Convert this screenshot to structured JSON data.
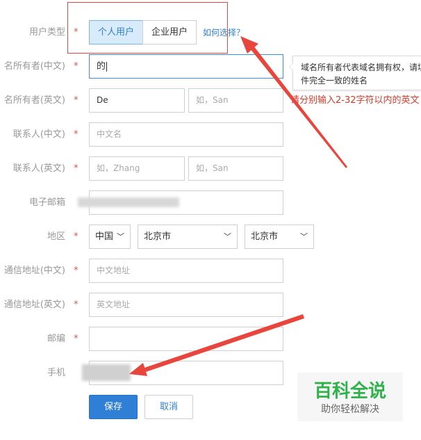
{
  "form": {
    "user_type": {
      "label": "用户类型",
      "required": "*",
      "options": [
        "个人用户",
        "企业用户"
      ],
      "selected": "个人用户",
      "help_link": "如何选择？"
    },
    "owner_cn": {
      "label": "名所有者(中文)",
      "required": "*",
      "value": "的"
    },
    "owner_en": {
      "label": "名所有者(英文)",
      "required": "*",
      "first_value": "De",
      "last_placeholder": "如，San"
    },
    "contact_cn": {
      "label": "联系人(中文)",
      "required": "*",
      "placeholder": "中文名"
    },
    "contact_en": {
      "label": "联系人(英文)",
      "required": "*",
      "first_placeholder": "如，Zhang",
      "last_placeholder": "如，San"
    },
    "email": {
      "label": "电子邮箱"
    },
    "region": {
      "label": "地区",
      "required": "*",
      "country": "中国",
      "province": "北京市",
      "city": "北京市"
    },
    "address_cn": {
      "label": "通信地址(中文)",
      "required": "*",
      "placeholder": "中文地址"
    },
    "address_en": {
      "label": "通信地址(英文)",
      "required": "*",
      "placeholder": "英文地址"
    },
    "postcode": {
      "label": "邮编",
      "required": "*"
    },
    "phone": {
      "label": "手机"
    },
    "buttons": {
      "save": "保存",
      "cancel": "取消"
    }
  },
  "tooltip": {
    "line1": "域名所有者代表域名拥有权，请填",
    "line2": "件完全一致的姓名"
  },
  "error_hint": "请分别输入2-32字符以内的英文",
  "watermark": {
    "title": "百科全说",
    "subtitle": "助你轻松解决"
  },
  "colors": {
    "accent": "#2f7fd6",
    "required": "#e0564b",
    "annotation": "#e8453c",
    "error": "#d63a2a",
    "watermark_green": "#2fb24a"
  }
}
